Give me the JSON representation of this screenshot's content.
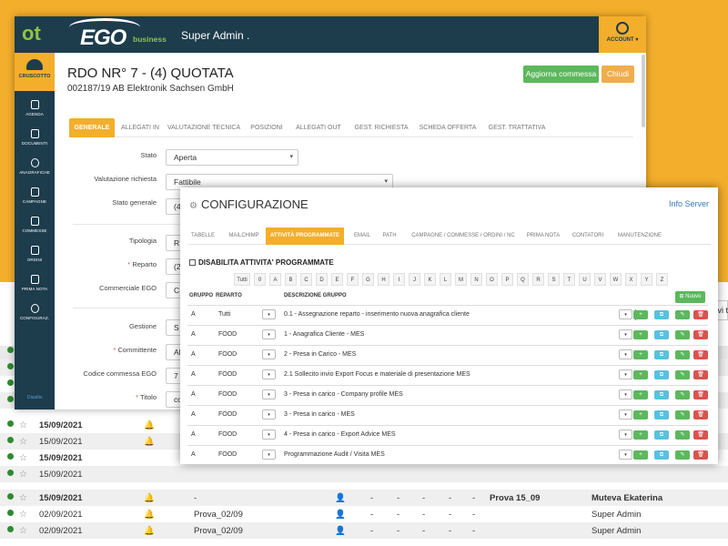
{
  "colors": {
    "accent": "#f3ae2b",
    "navy": "#1d3c4c",
    "green": "#5cb85c",
    "blue": "#5bc0de",
    "red": "#d9534f",
    "link": "#337ab7"
  },
  "topbar": {
    "logo_ot": "ot",
    "logo_ego": "EGO",
    "logo_business": "business",
    "user": "Super Admin .",
    "account_label": "ACCOUNT ▾"
  },
  "sidebar": {
    "active": "CRUSCOTTO",
    "items": [
      "AGENDA",
      "DOCUMENTI",
      "ANAGRAFICHE",
      "CAMPAGNE",
      "COMMESSE",
      "ORDINI",
      "PRIMA NOTA",
      "CONFIGURAZ."
    ],
    "footer": "Disattiv."
  },
  "rdo": {
    "title": "RDO NR° 7 - (4) QUOTATA",
    "subtitle": "002187/19 AB Elektronik Sachsen GmbH",
    "btn_update": "Aggiorna commessa",
    "btn_close": "Chiudi"
  },
  "rdo_tabs": [
    "GENERALE",
    "ALLEGATI IN",
    "VALUTAZIONE TECNICA",
    "POSIZIONI",
    "ALLEGATI OUT",
    "GEST. RICHIESTA",
    "SCHEDA OFFERTA",
    "GEST. TRATTATIVA"
  ],
  "form": {
    "stato_label": "Stato",
    "stato_value": "Aperta",
    "valutazione_label": "Valutazione richiesta",
    "valutazione_value": "Fattibile",
    "stato_generale_label": "Stato generale",
    "stato_generale_value": "(4",
    "tipologia_label": "Tipologia",
    "tipologia_value": "R",
    "reparto_label": "Reparto",
    "reparto_value": "(2",
    "commerciale_label": "Commerciale EGO",
    "commerciale_value": "C",
    "gestione_label": "Gestione",
    "gestione_value": "S",
    "committente_label": "Committente",
    "committente_value": "AE",
    "codice_label": "Codice commessa EGO",
    "codice_value": "7",
    "titolo_label": "Titolo",
    "titolo_value": "co"
  },
  "config": {
    "title": "CONFIGURAZIONE",
    "info_server": "Info Server",
    "tabs": [
      "TABELLE",
      "MAILCHIMP",
      "ATTIVITÀ PROGRAMMATE",
      "EMAIL",
      "PATH",
      "CAMPAGNE / COMMESSE / ORDINI / NC",
      "PRIMA NOTA",
      "CONTATORI",
      "MANUTENZIONE"
    ],
    "section_title": "DISABILITA ATTIVITA' PROGRAMMATE",
    "letters": [
      "Tutti",
      "0",
      "A",
      "B",
      "C",
      "D",
      "E",
      "F",
      "G",
      "H",
      "I",
      "J",
      "K",
      "L",
      "M",
      "N",
      "O",
      "P",
      "Q",
      "R",
      "S",
      "T",
      "U",
      "V",
      "W",
      "X",
      "Y",
      "Z"
    ],
    "btn_new": "Nuovo",
    "headers": {
      "gruppo": "GRUPPO",
      "reparto": "REPARTO",
      "descrizione": "DESCRIZIONE GRUPPO"
    },
    "rows": [
      {
        "gruppo": "A",
        "reparto": "Tutti",
        "descrizione": "0.1 - Assegnazione reparto - inserimento nuova anagrafica cliente"
      },
      {
        "gruppo": "A",
        "reparto": "FOOD",
        "descrizione": "1 - Anagrafica Cliente - MES"
      },
      {
        "gruppo": "A",
        "reparto": "FOOD",
        "descrizione": "2 - Presa in Carico - MES"
      },
      {
        "gruppo": "A",
        "reparto": "FOOD",
        "descrizione": "2.1 Sollecito invio Export Focus e materiale di presentazione MES"
      },
      {
        "gruppo": "A",
        "reparto": "FOOD",
        "descrizione": "3 - Presa in carico - Company profile MES"
      },
      {
        "gruppo": "A",
        "reparto": "FOOD",
        "descrizione": "3 - Presa in carico - MES"
      },
      {
        "gruppo": "A",
        "reparto": "FOOD",
        "descrizione": "4 - Presa in carico - Export Advice MES"
      },
      {
        "gruppo": "A",
        "reparto": "FOOD",
        "descrizione": "Programmazione Audit / Visita MES"
      }
    ]
  },
  "background_list": {
    "peek_text": "ovi t",
    "rows": [
      {
        "date": "15/09/2021",
        "bold": true,
        "name": "",
        "dash": "",
        "c1": "",
        "c2": "",
        "c3": "",
        "c4": "",
        "c5": "",
        "proj": "",
        "user": ""
      },
      {
        "date": "15/09/2021",
        "bold": false,
        "name": "",
        "dash": "",
        "c1": "",
        "c2": "",
        "c3": "",
        "c4": "",
        "c5": "",
        "proj": "",
        "user": ""
      },
      {
        "date": "15/09/2021",
        "bold": true,
        "name": "",
        "dash": "",
        "c1": "",
        "c2": "",
        "c3": "",
        "c4": "",
        "c5": "",
        "proj": "",
        "user": ""
      },
      {
        "date": "15/09/2021",
        "bold": false,
        "name": "",
        "dash": "",
        "c1": "",
        "c2": "",
        "c3": "",
        "c4": "",
        "c5": "",
        "proj": "",
        "user": ""
      },
      {
        "date": "15/09/2021",
        "bold": true,
        "name": "-",
        "dash": "",
        "c1": "-",
        "c2": "-",
        "c3": "-",
        "c4": "-",
        "c5": "-",
        "proj": "Prova 15_09",
        "user": "Muteva Ekaterina"
      },
      {
        "date": "02/09/2021",
        "bold": false,
        "name": "Prova_02/09",
        "dash": "",
        "c1": "-",
        "c2": "-",
        "c3": "-",
        "c4": "-",
        "c5": "-",
        "proj": "",
        "user": "Super Admin"
      },
      {
        "date": "02/09/2021",
        "bold": false,
        "name": "Prova_02/09",
        "dash": "",
        "c1": "-",
        "c2": "-",
        "c3": "-",
        "c4": "-",
        "c5": "-",
        "proj": "",
        "user": "Super Admin"
      }
    ]
  }
}
